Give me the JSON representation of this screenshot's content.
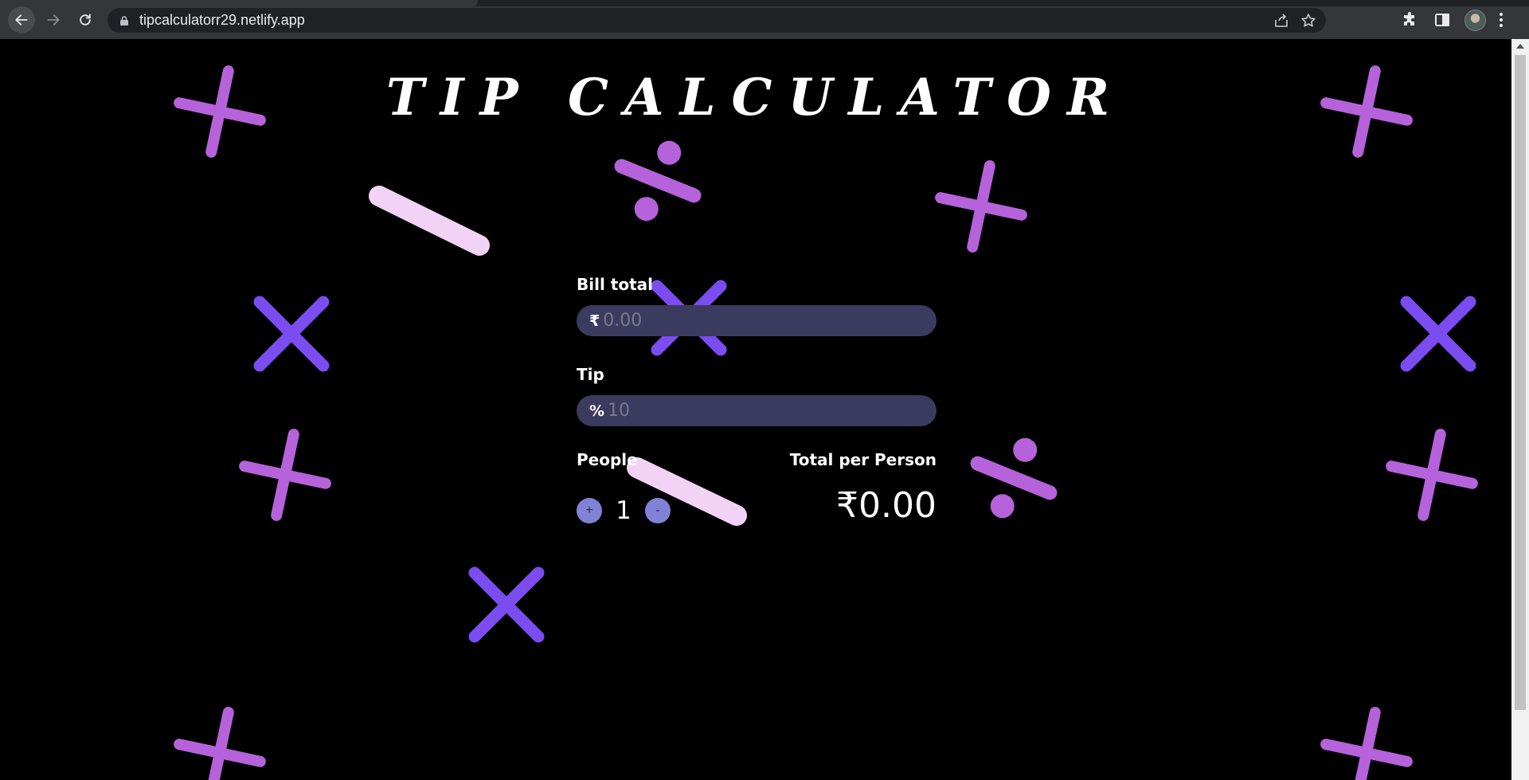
{
  "browser": {
    "url": "tipcalculatorr29.netlify.app"
  },
  "app": {
    "title": "TIP CALCULATOR",
    "bill": {
      "label": "Bill total",
      "symbol": "₹",
      "placeholder": "0.00",
      "value": ""
    },
    "tip": {
      "label": "Tip",
      "symbol": "%",
      "placeholder": "10",
      "value": ""
    },
    "people": {
      "label": "People",
      "increment_label": "+",
      "count": "1",
      "decrement_label": "-"
    },
    "total": {
      "label": "Total per Person",
      "value": "₹0.00"
    }
  },
  "colors": {
    "plus_purple": "#b562db",
    "x_violet": "#7b4cf0",
    "minus_pink": "#f2d2f5",
    "divide_purple": "#b562db",
    "input_bg": "#3b3a5f",
    "step_button": "#8181d6",
    "page_bg": "#000000"
  }
}
